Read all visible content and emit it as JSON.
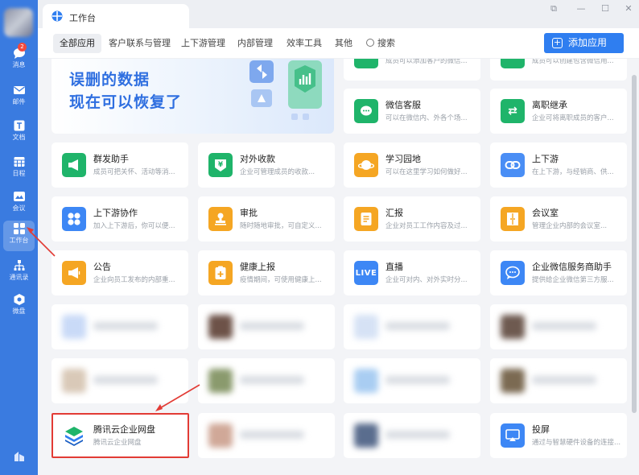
{
  "sidebar": {
    "items": [
      {
        "label": "消息",
        "icon": "message-icon",
        "badge": "2"
      },
      {
        "label": "邮件",
        "icon": "mail-icon"
      },
      {
        "label": "文档",
        "icon": "document-icon"
      },
      {
        "label": "日程",
        "icon": "calendar-icon"
      },
      {
        "label": "会议",
        "icon": "meeting-icon"
      },
      {
        "label": "工作台",
        "icon": "workbench-icon",
        "active": true
      },
      {
        "label": "通讯录",
        "icon": "contacts-icon"
      },
      {
        "label": "微盘",
        "icon": "drive-icon"
      }
    ]
  },
  "window": {
    "tab_title": "工作台",
    "controls": [
      "pin-icon",
      "minimize-icon",
      "maximize-icon",
      "close-icon"
    ]
  },
  "tabs": [
    "全部应用",
    "客户联系与管理",
    "上下游管理",
    "内部管理",
    "效率工具",
    "其他"
  ],
  "search_label": "搜索",
  "add_app_label": "添加应用",
  "banner": {
    "line1": "误删的数据",
    "line2": "现在可以恢复了"
  },
  "cards": [
    {
      "title": "",
      "desc": "成员可以添加客户的微信...",
      "color": "#1fb46a"
    },
    {
      "title": "",
      "desc": "成员可以创建包含微信用...",
      "color": "#1fb46a"
    },
    {
      "title": "微信客服",
      "desc": "可以在微信内、外各个场...",
      "color": "#1fb46a"
    },
    {
      "title": "离职继承",
      "desc": "企业可将离职成员的客户...",
      "color": "#1fb46a"
    },
    {
      "title": "群发助手",
      "desc": "成员可把关怀、活动等消...",
      "color": "#1fb46a"
    },
    {
      "title": "对外收款",
      "desc": "企业可管理成员的收款...",
      "color": "#1fb46a"
    },
    {
      "title": "学习园地",
      "desc": "可以在这里学习如何做好...",
      "color": "#f5a623"
    },
    {
      "title": "上下游",
      "desc": "在上下游，与经销商、供...",
      "color": "#4a8ef5"
    },
    {
      "title": "上下游协作",
      "desc": "加入上下游后，你可以便...",
      "color": "#3d87f5"
    },
    {
      "title": "审批",
      "desc": "随时随地审批，可自定义...",
      "color": "#f5a623"
    },
    {
      "title": "汇报",
      "desc": "企业对员工工作内容及过...",
      "color": "#f5a623"
    },
    {
      "title": "会议室",
      "desc": "管理企业内部的会议室...",
      "color": "#f5a623"
    },
    {
      "title": "公告",
      "desc": "企业向员工发布的内部重...",
      "color": "#f5a623"
    },
    {
      "title": "健康上报",
      "desc": "疫情期间，可使用健康上...",
      "color": "#f5a623"
    },
    {
      "title": "直播",
      "desc": "企业可对内、对外实时分...",
      "color": "#3d87f5"
    },
    {
      "title": "企业微信服务商助手",
      "desc": "提供给企业微信第三方服...",
      "color": "#3d87f5"
    },
    {
      "title": "腾讯云企业网盘",
      "desc": "腾讯云企业网盘",
      "color": "#ffffff"
    },
    {
      "title": "投屏",
      "desc": "通过与智慧硬件设备的连接...",
      "color": "#3d87f5"
    }
  ],
  "colors": {
    "accent": "#2f7ef0",
    "sidebar": "#3a7be0",
    "highlight": "#e23b35"
  }
}
